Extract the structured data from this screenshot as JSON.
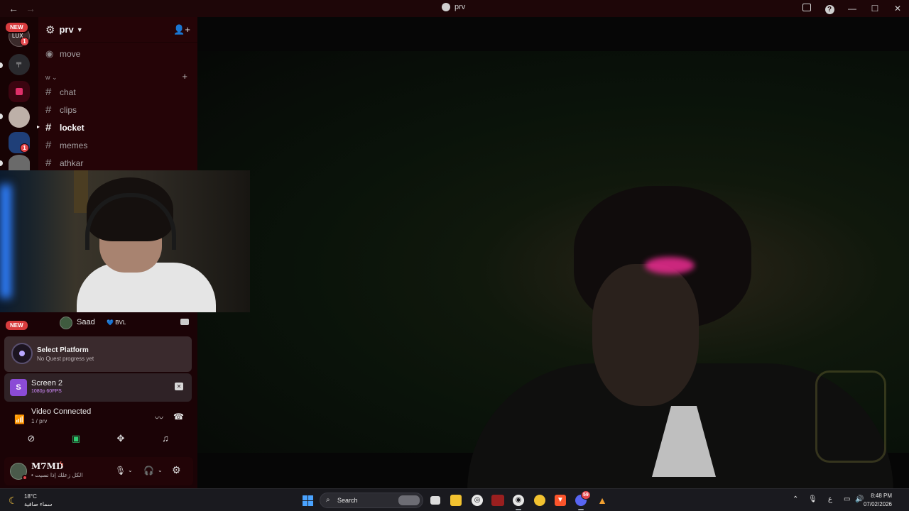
{
  "window": {
    "title": "prv",
    "nav_back": "←",
    "nav_forward": "→",
    "controls": {
      "minimize": "—",
      "maximize": "☐",
      "close": "✕"
    }
  },
  "guilds": {
    "new_badge_top": "NEW",
    "lux_label": "LUX",
    "lux_ping": "1",
    "blue_ping": "1",
    "new_badge_bottom": "NEW"
  },
  "server": {
    "name": "prv",
    "voice_channel": "move",
    "category": "w",
    "channels": [
      {
        "name": "chat",
        "active": false
      },
      {
        "name": "clips",
        "active": false
      },
      {
        "name": "locket",
        "active": true
      },
      {
        "name": "memes",
        "active": false
      },
      {
        "name": "athkar",
        "active": false
      }
    ]
  },
  "voice": {
    "member_name": "Saad",
    "member_tag": "BVL",
    "quest_title": "Select Platform",
    "quest_subtitle": "No Quest progress yet",
    "stream_title": "Screen 2",
    "stream_quality": "1080p 60FPS",
    "status_title": "Video Connected",
    "status_channel": "1 / prv"
  },
  "user": {
    "name": "M7MD",
    "status_text": "• الكل زعلك إذا نسيت"
  },
  "taskbar": {
    "temperature": "18°C",
    "weather": "سماء صافية",
    "search_label": "Search",
    "lang": "ع",
    "time": "8:48 PM",
    "date": "07/02/2026",
    "discord_badge": "59"
  }
}
